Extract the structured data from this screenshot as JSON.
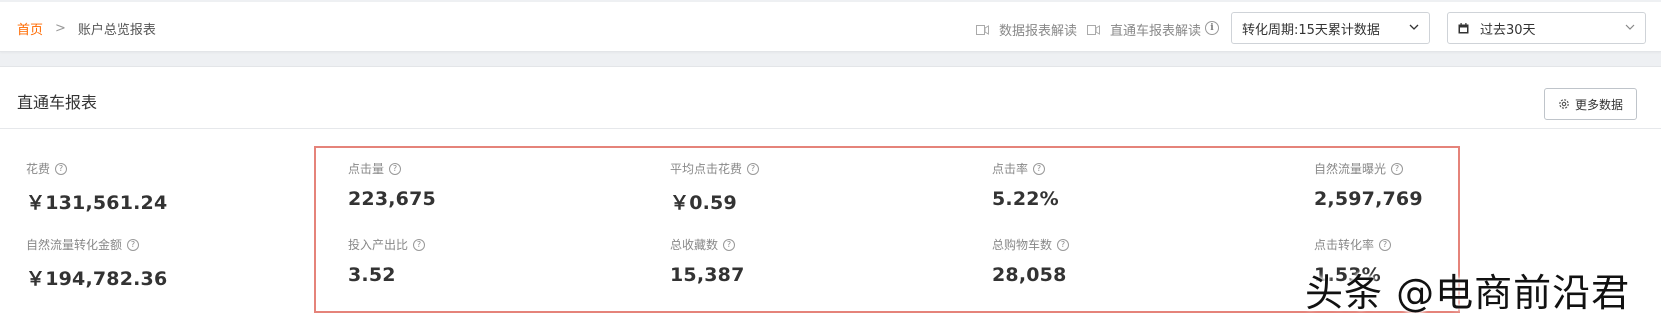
{
  "breadcrumb": {
    "home": "首页",
    "separator": ">",
    "current": "账户总览报表"
  },
  "top_actions": {
    "data_report_link": "数据报表解读",
    "ztc_report_link": "直通车报表解读",
    "conversion_select": "转化周期:15天累计数据",
    "date_select": "过去30天"
  },
  "panel": {
    "title": "直通车报表",
    "more_button": "更多数据"
  },
  "metrics_row1": [
    {
      "label": "花费",
      "value": "￥131,561.24"
    },
    {
      "label": "点击量",
      "value": "223,675"
    },
    {
      "label": "平均点击花费",
      "value": "￥0.59"
    },
    {
      "label": "点击率",
      "value": "5.22%"
    },
    {
      "label": "自然流量曝光",
      "value": "2,597,769"
    }
  ],
  "metrics_row2": [
    {
      "label": "自然流量转化金额",
      "value": "￥194,782.36"
    },
    {
      "label": "投入产出比",
      "value": "3.52"
    },
    {
      "label": "总收藏数",
      "value": "15,387"
    },
    {
      "label": "总购物车数",
      "value": "28,058"
    },
    {
      "label": "点击转化率",
      "value": "1.53%"
    }
  ],
  "watermark": "头条 @电商前沿君",
  "colors": {
    "accent": "#ff6a00",
    "highlight_border": "#e5837a"
  },
  "icons": [
    "video-icon",
    "info-icon",
    "chevron-down-icon",
    "calendar-icon",
    "gear-icon",
    "help-icon"
  ]
}
